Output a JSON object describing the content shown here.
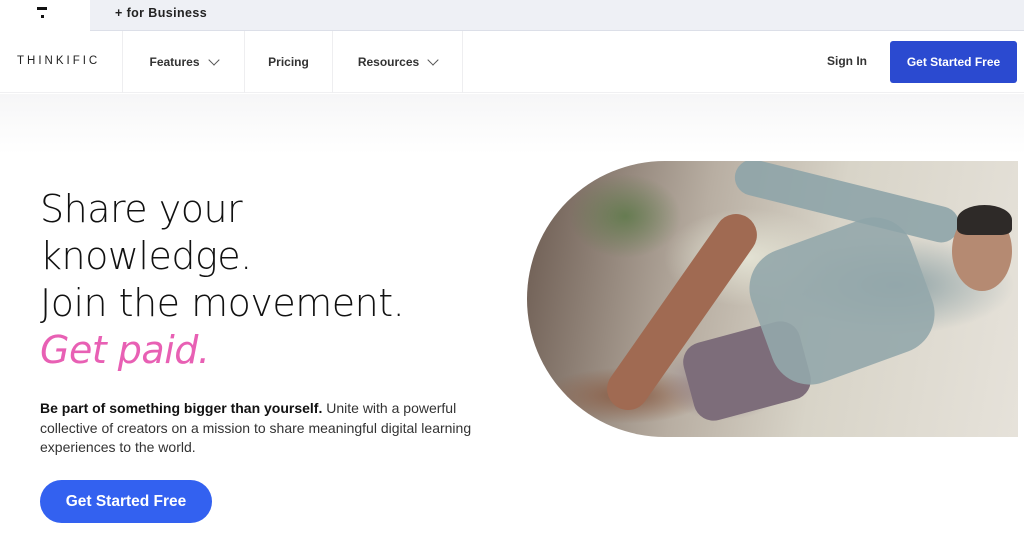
{
  "topbar": {
    "logo_icon": "thinkific-mark-icon",
    "business_link": "+ for Business"
  },
  "nav": {
    "brand": "THINKIFIC",
    "items": [
      {
        "label": "Features",
        "has_dropdown": true
      },
      {
        "label": "Pricing",
        "has_dropdown": false
      },
      {
        "label": "Resources",
        "has_dropdown": true
      }
    ],
    "sign_in": "Sign In",
    "cta": "Get Started Free"
  },
  "hero": {
    "headline": [
      "Share your",
      "knowledge.",
      "Join the movement."
    ],
    "headline_accent": "Get paid.",
    "sub_bold": "Be part of something bigger than yourself.",
    "sub_rest": " Unite with a powerful collective of creators on a mission to share meaningful digital learning experiences to the world.",
    "cta": "Get Started Free",
    "image_alt": "Man stretching in yoga pose indoors"
  },
  "colors": {
    "nav_cta": "#2b4ad0",
    "hero_cta": "#3361f0",
    "accent_pink": "#e860b4",
    "topbar_bg": "#eef0f5"
  }
}
